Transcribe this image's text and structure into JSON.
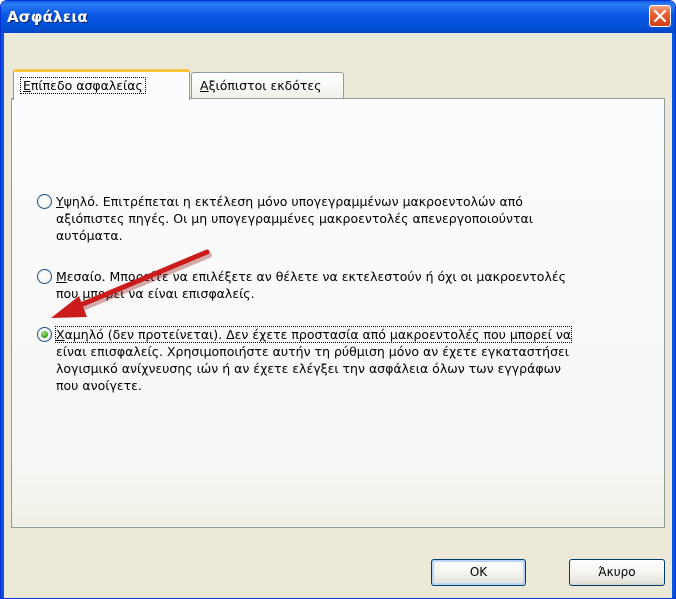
{
  "window": {
    "title": "Ασφάλεια"
  },
  "tabs": [
    {
      "label": "Επίπεδο ασφαλείας",
      "mnemonic": "Ε",
      "rest": "πίπεδο ασφαλείας",
      "active": true
    },
    {
      "label": "Αξιόπιστοι εκδότες",
      "mnemonic": "Α",
      "rest": "ξιόπιστοι εκδότες",
      "active": false
    }
  ],
  "security_levels": [
    {
      "mnemonic": "Υ",
      "lines": [
        "ψηλό. Επιτρέπεται η εκτέλεση μόνο υπογεγραμμένων μακροεντολών από",
        "αξιόπιστες πηγές. Οι μη υπογεγραμμένες μακροεντολές απενεργοποιούνται",
        "αυτόματα."
      ],
      "checked": false
    },
    {
      "mnemonic": "Μ",
      "lines": [
        "εσαίο. Μπορείτε να επιλέξετε αν θέλετε να εκτελεστούν ή όχι οι μακροεντολές",
        "που μπορεί να είναι επισφαλείς."
      ],
      "checked": false
    },
    {
      "mnemonic": "Χ",
      "lines": [
        "αμηλό (δεν προτείνεται). Δεν έχετε προστασία από μακροεντολές που μπορεί να",
        "είναι επισφαλείς. Χρησιμοποιήστε αυτήν τη ρύθμιση μόνο αν έχετε εγκαταστήσει",
        "λογισμικό ανίχνευσης ιών ή αν έχετε ελέγξει την ασφάλεια όλων των εγγράφων",
        "που ανοίγετε."
      ],
      "checked": true
    }
  ],
  "buttons": {
    "ok": "OK",
    "cancel": "Άκυρο"
  },
  "colors": {
    "titlebar": "#0a5fe6",
    "arrow": "#cc1b1b",
    "tab_highlight": "#ffc83c",
    "radio_checked": "#3fa31e"
  },
  "icons": {
    "close": "close-icon",
    "annotation": "red-arrow-annotation"
  }
}
